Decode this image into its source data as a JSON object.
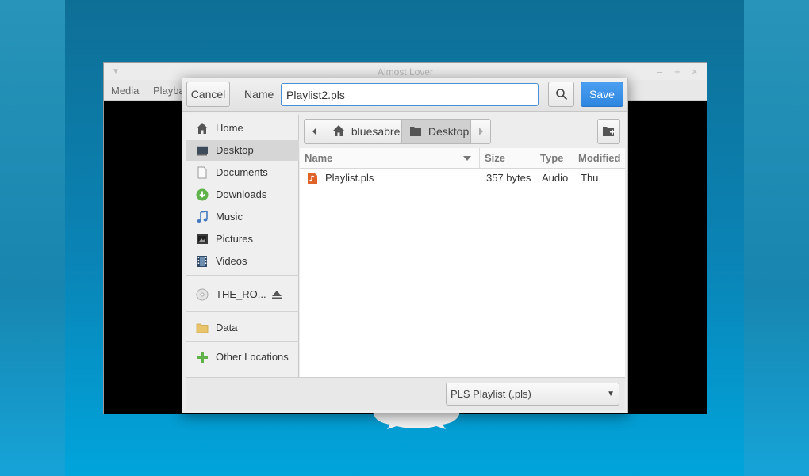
{
  "vlc": {
    "title": "Almost Lover",
    "menu": [
      "Media",
      "Playba"
    ]
  },
  "dialog": {
    "cancel_label": "Cancel",
    "name_label": "Name",
    "filename": "Playlist2.pls",
    "save_label": "Save",
    "sidebar": {
      "home": "Home",
      "desktop": "Desktop",
      "documents": "Documents",
      "downloads": "Downloads",
      "music": "Music",
      "pictures": "Pictures",
      "videos": "Videos",
      "drive": "THE_RO...",
      "data": "Data",
      "other": "Other Locations"
    },
    "path": {
      "home": "bluesabre",
      "current": "Desktop"
    },
    "columns": {
      "name": "Name",
      "size": "Size",
      "type": "Type",
      "modified": "Modified"
    },
    "files": [
      {
        "name": "Playlist.pls",
        "size": "357 bytes",
        "type": "Audio",
        "modified": "Thu"
      }
    ],
    "filter": "PLS Playlist (.pls)"
  },
  "colors": {
    "accent": "#3b8fe3",
    "desktop": "#0b7fab"
  }
}
